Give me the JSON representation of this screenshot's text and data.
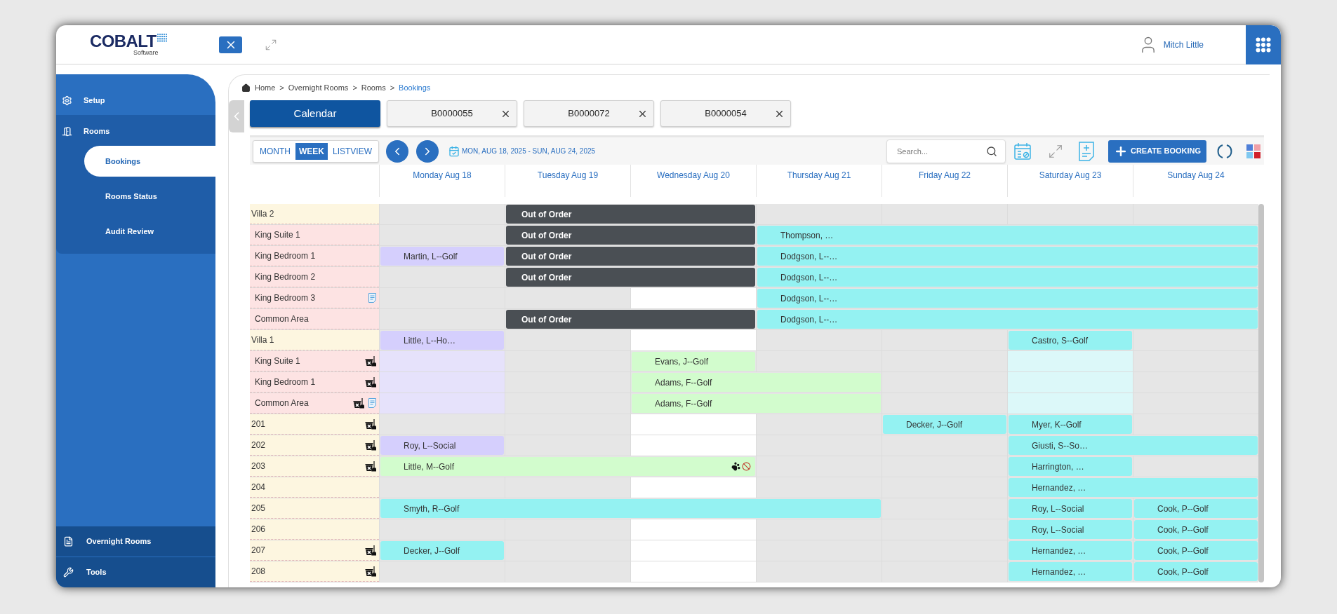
{
  "header": {
    "logo": "COBALT",
    "logo_sub": "Software",
    "user": "Mitch Little"
  },
  "sidebar": {
    "items": [
      {
        "label": "Setup",
        "selected": false
      },
      {
        "label": "Rooms",
        "selected": false,
        "children": [
          {
            "label": "Bookings",
            "selected": true
          },
          {
            "label": "Rooms Status",
            "selected": false
          },
          {
            "label": "Audit Review",
            "selected": false
          }
        ]
      }
    ],
    "bottom_items": [
      {
        "label": "Overnight Rooms"
      },
      {
        "label": "Tools"
      }
    ]
  },
  "breadcrumb": [
    {
      "kind": "link",
      "label": "Home",
      "current": false
    },
    {
      "kind": "separator",
      "label": ">"
    },
    {
      "kind": "link",
      "label": "Overnight Rooms",
      "current": false
    },
    {
      "kind": "separator",
      "label": ">"
    },
    {
      "kind": "link",
      "label": "Rooms",
      "current": false
    },
    {
      "kind": "separator",
      "label": ">"
    },
    {
      "kind": "link",
      "label": "Bookings",
      "current": true
    }
  ],
  "tabs": [
    {
      "label": "Calendar",
      "selected": true,
      "closable": false
    },
    {
      "label": "B0000055",
      "selected": false,
      "closable": true
    },
    {
      "label": "B0000072",
      "selected": false,
      "closable": true
    },
    {
      "label": "B0000054",
      "selected": false,
      "closable": true
    }
  ],
  "toolbar": {
    "views": [
      {
        "label": "MONTH",
        "selected": false
      },
      {
        "label": "WEEK",
        "selected": true
      },
      {
        "label": "LISTVIEW",
        "selected": false
      }
    ],
    "range": "MON, AUG 18, 2025 - SUN, AUG 24, 2025",
    "search": {
      "placeholder": "Search..."
    },
    "create": "CREATE BOOKING"
  },
  "days": [
    "Monday Aug 18",
    "Tuesday Aug 19",
    "Wednesday Aug 20",
    "Thursday Aug 21",
    "Friday Aug 22",
    "Saturday Aug 23",
    "Sunday Aug 24"
  ],
  "rows": [
    {
      "name": "Villa 2",
      "kind": "property",
      "housekeeping": false,
      "note": false,
      "cells": [
        {
          "kind": "empty",
          "open": false
        },
        {
          "kind": "booking",
          "booking": {
            "kind": "out_of_order",
            "text": "Out of Order"
          }
        },
        {
          "kind": "continued"
        },
        {
          "kind": "empty",
          "open": false
        },
        {
          "kind": "empty",
          "open": false
        },
        {
          "kind": "empty",
          "open": false
        },
        {
          "kind": "empty",
          "open": false
        }
      ]
    },
    {
      "name": "King Suite 1",
      "kind": "unit",
      "housekeeping": false,
      "note": false,
      "cells": [
        {
          "kind": "empty",
          "open": false
        },
        {
          "kind": "booking",
          "booking": {
            "kind": "out_of_order",
            "text": "Out of Order"
          }
        },
        {
          "kind": "continued"
        },
        {
          "kind": "booking",
          "booking": {
            "kind": "guest",
            "text": "Thompson, …",
            "color": "#94f2f2"
          }
        },
        {
          "kind": "continued"
        },
        {
          "kind": "continued"
        },
        {
          "kind": "continued"
        }
      ]
    },
    {
      "name": "King Bedroom 1",
      "kind": "unit",
      "housekeeping": false,
      "note": false,
      "cells": [
        {
          "kind": "booking",
          "booking": {
            "kind": "guest",
            "text": "Martin, L--Golf",
            "color": "#d5cffd"
          }
        },
        {
          "kind": "booking",
          "booking": {
            "kind": "out_of_order",
            "text": "Out of Order"
          }
        },
        {
          "kind": "continued"
        },
        {
          "kind": "booking",
          "booking": {
            "kind": "guest",
            "text": "Dodgson, L--…",
            "color": "#94f2f2"
          }
        },
        {
          "kind": "continued"
        },
        {
          "kind": "continued"
        },
        {
          "kind": "continued"
        }
      ]
    },
    {
      "name": "King Bedroom 2",
      "kind": "unit",
      "housekeeping": false,
      "note": false,
      "cells": [
        {
          "kind": "empty",
          "open": false
        },
        {
          "kind": "booking",
          "booking": {
            "kind": "out_of_order",
            "text": "Out of Order"
          }
        },
        {
          "kind": "continued"
        },
        {
          "kind": "booking",
          "booking": {
            "kind": "guest",
            "text": "Dodgson, L--…",
            "color": "#94f2f2"
          }
        },
        {
          "kind": "continued"
        },
        {
          "kind": "continued"
        },
        {
          "kind": "continued"
        }
      ]
    },
    {
      "name": "King Bedroom 3",
      "kind": "unit",
      "housekeeping": false,
      "note": true,
      "cells": [
        {
          "kind": "empty",
          "open": false
        },
        {
          "kind": "empty",
          "open": false
        },
        {
          "kind": "empty",
          "open": true
        },
        {
          "kind": "booking",
          "booking": {
            "kind": "guest",
            "text": "Dodgson, L--…",
            "color": "#94f2f2"
          }
        },
        {
          "kind": "continued"
        },
        {
          "kind": "continued"
        },
        {
          "kind": "continued"
        }
      ]
    },
    {
      "name": "Common Area",
      "kind": "unit",
      "housekeeping": false,
      "note": false,
      "cells": [
        {
          "kind": "empty",
          "open": false
        },
        {
          "kind": "booking",
          "booking": {
            "kind": "out_of_order",
            "text": "Out of Order"
          }
        },
        {
          "kind": "continued"
        },
        {
          "kind": "booking",
          "booking": {
            "kind": "guest",
            "text": "Dodgson, L--…",
            "color": "#94f2f2"
          }
        },
        {
          "kind": "continued"
        },
        {
          "kind": "continued"
        },
        {
          "kind": "continued"
        }
      ]
    },
    {
      "name": "Villa 1",
      "kind": "property",
      "housekeeping": false,
      "note": false,
      "cells": [
        {
          "kind": "booking",
          "booking": {
            "kind": "guest",
            "text": "Little, L--Ho…",
            "color": "#d5cffd"
          }
        },
        {
          "kind": "empty",
          "open": false
        },
        {
          "kind": "empty",
          "open": true
        },
        {
          "kind": "empty",
          "open": false
        },
        {
          "kind": "empty",
          "open": false
        },
        {
          "kind": "booking",
          "booking": {
            "kind": "guest",
            "text": "Castro, S--Golf",
            "color": "#94f2f2"
          }
        },
        {
          "kind": "empty",
          "open": false
        }
      ]
    },
    {
      "name": "King Suite 1",
      "kind": "unit",
      "housekeeping": true,
      "note": false,
      "cells": [
        {
          "kind": "held",
          "color": "#e6e2fb"
        },
        {
          "kind": "empty",
          "open": false
        },
        {
          "kind": "booking",
          "booking": {
            "kind": "guest",
            "text": "Evans, J--Golf",
            "color": "#d2fccd"
          }
        },
        {
          "kind": "empty",
          "open": false
        },
        {
          "kind": "empty",
          "open": false
        },
        {
          "kind": "held",
          "color": "#dcf8f9"
        },
        {
          "kind": "empty",
          "open": false
        }
      ]
    },
    {
      "name": "King Bedroom 1",
      "kind": "unit",
      "housekeeping": true,
      "note": false,
      "cells": [
        {
          "kind": "held",
          "color": "#e6e2fb"
        },
        {
          "kind": "empty",
          "open": false
        },
        {
          "kind": "booking",
          "booking": {
            "kind": "guest",
            "text": "Adams, F--Golf",
            "color": "#d2fccd"
          }
        },
        {
          "kind": "continued"
        },
        {
          "kind": "empty",
          "open": false
        },
        {
          "kind": "held",
          "color": "#dcf8f9"
        },
        {
          "kind": "empty",
          "open": false
        }
      ]
    },
    {
      "name": "Common Area",
      "kind": "unit",
      "housekeeping": true,
      "note": true,
      "cells": [
        {
          "kind": "held",
          "color": "#e6e2fb"
        },
        {
          "kind": "empty",
          "open": false
        },
        {
          "kind": "booking",
          "booking": {
            "kind": "guest",
            "text": "Adams, F--Golf",
            "color": "#d2fccd"
          }
        },
        {
          "kind": "continued"
        },
        {
          "kind": "empty",
          "open": false
        },
        {
          "kind": "held",
          "color": "#dcf8f9"
        },
        {
          "kind": "empty",
          "open": false
        }
      ]
    },
    {
      "name": "201",
      "kind": "property",
      "housekeeping": true,
      "note": false,
      "cells": [
        {
          "kind": "empty",
          "open": false
        },
        {
          "kind": "empty",
          "open": false
        },
        {
          "kind": "empty",
          "open": true
        },
        {
          "kind": "empty",
          "open": false
        },
        {
          "kind": "booking",
          "booking": {
            "kind": "guest",
            "text": "Decker, J--Golf",
            "color": "#94f2f2"
          }
        },
        {
          "kind": "booking",
          "booking": {
            "kind": "guest",
            "text": "Myer, K--Golf",
            "color": "#94f2f2"
          }
        },
        {
          "kind": "empty",
          "open": false
        }
      ]
    },
    {
      "name": "202",
      "kind": "property",
      "housekeeping": true,
      "note": false,
      "cells": [
        {
          "kind": "booking",
          "booking": {
            "kind": "guest",
            "text": "Roy, L--Social",
            "color": "#d5cffd"
          }
        },
        {
          "kind": "empty",
          "open": false
        },
        {
          "kind": "empty",
          "open": true
        },
        {
          "kind": "empty",
          "open": false
        },
        {
          "kind": "empty",
          "open": false
        },
        {
          "kind": "booking",
          "booking": {
            "kind": "guest",
            "text": "Giusti, S--So…",
            "color": "#94f2f2"
          }
        },
        {
          "kind": "continued"
        }
      ]
    },
    {
      "name": "203",
      "kind": "property",
      "housekeeping": true,
      "note": false,
      "cells": [
        {
          "kind": "booking",
          "booking": {
            "kind": "guest",
            "text": "Little, M--Golf",
            "color": "#d2fccd",
            "pet": true,
            "no_smoking": true
          }
        },
        {
          "kind": "continued"
        },
        {
          "kind": "continued"
        },
        {
          "kind": "empty",
          "open": false
        },
        {
          "kind": "empty",
          "open": false
        },
        {
          "kind": "booking",
          "booking": {
            "kind": "guest",
            "text": "Harrington, …",
            "color": "#94f2f2"
          }
        },
        {
          "kind": "empty",
          "open": false
        }
      ]
    },
    {
      "name": "204",
      "kind": "property",
      "housekeeping": false,
      "note": false,
      "cells": [
        {
          "kind": "empty",
          "open": false
        },
        {
          "kind": "empty",
          "open": false
        },
        {
          "kind": "empty",
          "open": true
        },
        {
          "kind": "empty",
          "open": false
        },
        {
          "kind": "empty",
          "open": false
        },
        {
          "kind": "booking",
          "booking": {
            "kind": "guest",
            "text": "Hernandez, …",
            "color": "#94f2f2"
          }
        },
        {
          "kind": "continued"
        }
      ]
    },
    {
      "name": "205",
      "kind": "property",
      "housekeeping": false,
      "note": false,
      "cells": [
        {
          "kind": "booking",
          "booking": {
            "kind": "guest",
            "text": "Smyth, R--Golf",
            "color": "#94f2f2"
          }
        },
        {
          "kind": "continued"
        },
        {
          "kind": "continued"
        },
        {
          "kind": "continued"
        },
        {
          "kind": "empty",
          "open": false
        },
        {
          "kind": "booking",
          "booking": {
            "kind": "guest",
            "text": "Roy, L--Social",
            "color": "#94f2f2"
          }
        },
        {
          "kind": "booking",
          "booking": {
            "kind": "guest",
            "text": "Cook, P--Golf",
            "color": "#94f2f2"
          }
        }
      ]
    },
    {
      "name": "206",
      "kind": "property",
      "housekeeping": false,
      "note": false,
      "cells": [
        {
          "kind": "empty",
          "open": false
        },
        {
          "kind": "empty",
          "open": false
        },
        {
          "kind": "empty",
          "open": true
        },
        {
          "kind": "empty",
          "open": false
        },
        {
          "kind": "empty",
          "open": false
        },
        {
          "kind": "booking",
          "booking": {
            "kind": "guest",
            "text": "Roy, L--Social",
            "color": "#94f2f2"
          }
        },
        {
          "kind": "booking",
          "booking": {
            "kind": "guest",
            "text": "Cook, P--Golf",
            "color": "#94f2f2"
          }
        }
      ]
    },
    {
      "name": "207",
      "kind": "property",
      "housekeeping": true,
      "note": false,
      "cells": [
        {
          "kind": "booking",
          "booking": {
            "kind": "guest",
            "text": "Decker, J--Golf",
            "color": "#94f2f2"
          }
        },
        {
          "kind": "empty",
          "open": false
        },
        {
          "kind": "empty",
          "open": true
        },
        {
          "kind": "empty",
          "open": false
        },
        {
          "kind": "empty",
          "open": false
        },
        {
          "kind": "booking",
          "booking": {
            "kind": "guest",
            "text": "Hernandez, …",
            "color": "#94f2f2"
          }
        },
        {
          "kind": "booking",
          "booking": {
            "kind": "guest",
            "text": "Cook, P--Golf",
            "color": "#94f2f2"
          }
        }
      ]
    },
    {
      "name": "208",
      "kind": "property",
      "housekeeping": true,
      "note": false,
      "cells": [
        {
          "kind": "empty",
          "open": false
        },
        {
          "kind": "empty",
          "open": false
        },
        {
          "kind": "empty",
          "open": true
        },
        {
          "kind": "empty",
          "open": false
        },
        {
          "kind": "empty",
          "open": false
        },
        {
          "kind": "booking",
          "booking": {
            "kind": "guest",
            "text": "Hernandez, …",
            "color": "#94f2f2"
          }
        },
        {
          "kind": "booking",
          "booking": {
            "kind": "guest",
            "text": "Cook, P--Golf",
            "color": "#94f2f2"
          }
        }
      ]
    }
  ]
}
